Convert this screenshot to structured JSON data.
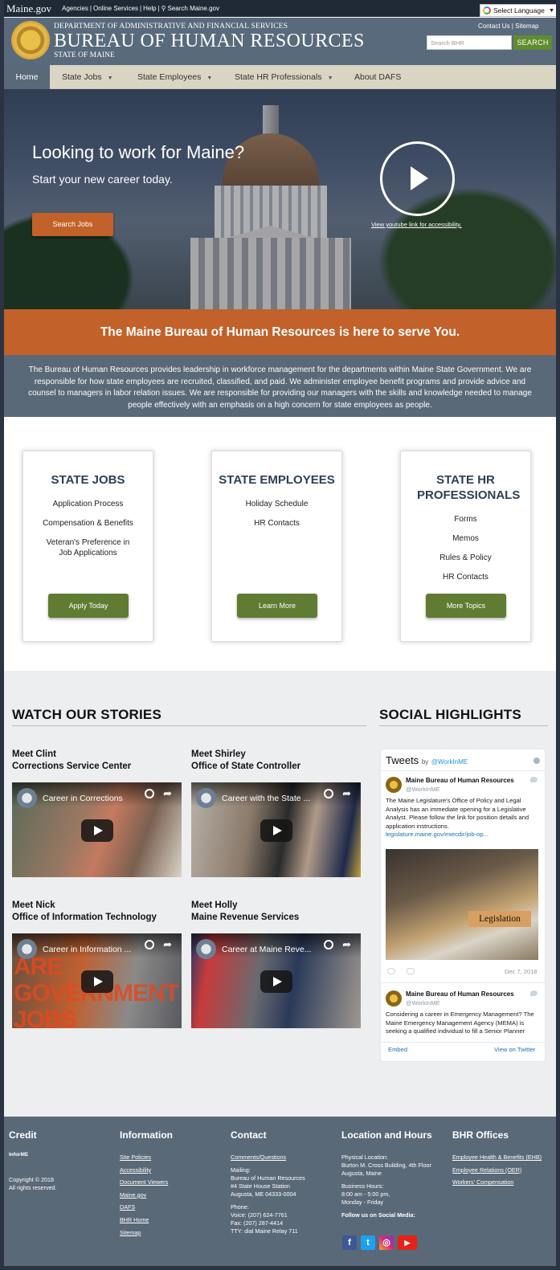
{
  "util": {
    "site": "Maine.gov",
    "links": [
      "Agencies",
      "|",
      "Online Services",
      "|",
      "Help",
      "|",
      "Search Maine.gov"
    ],
    "language": "Select Language"
  },
  "header": {
    "dept": "DEPARTMENT OF ADMINISTRATIVE AND FINANCIAL SERVICES",
    "title": "BUREAU OF HUMAN RESOURCES",
    "state": "STATE OF MAINE",
    "contact": "Contact Us",
    "sep": "|",
    "sitemap": "Sitemap",
    "search_placeholder": "Search BHR",
    "search_button": "SEARCH"
  },
  "nav": {
    "home": "Home",
    "state_jobs": "State Jobs",
    "state_employees": "State Employees",
    "state_hr": "State HR Professionals",
    "about": "About DAFS"
  },
  "hero": {
    "headline": "Looking to work for Maine?",
    "subline": "Start your new career today.",
    "button": "Search Jobs",
    "yt_link": "View youtube link for accessibility."
  },
  "band": "The Maine Bureau of Human Resources is here to serve You.",
  "intro": "The Bureau of Human Resources provides leadership in workforce management for the departments within Maine State Government. We are responsible for how state employees are recruited, classified, and paid. We administer employee benefit programs and provide advice and counsel to managers in labor relation issues. We are responsible for providing our managers with the skills and knowledge needed to manage people effectively with an emphasis on a high concern for state employees as people.",
  "cards": [
    {
      "title": "STATE JOBS",
      "items": [
        "Application Process",
        "Compensation & Benefits",
        "Veteran's Preference in Job Applications"
      ],
      "button": "Apply Today"
    },
    {
      "title": "STATE EMPLOYEES",
      "items": [
        "Holiday Schedule",
        "HR Contacts"
      ],
      "button": "Learn More"
    },
    {
      "title": "STATE HR PROFESSIONALS",
      "items": [
        "Forms",
        "Memos",
        "Rules & Policy",
        "HR Contacts"
      ],
      "button": "More Topics"
    }
  ],
  "stories": {
    "heading": "WATCH OUR STORIES",
    "items": [
      {
        "name": "Meet Clint",
        "org": "Corrections Service Center",
        "video": "Career in Corrections"
      },
      {
        "name": "Meet Shirley",
        "org": "Office of State Controller",
        "video": "Career with the State ..."
      },
      {
        "name": "Meet Nick",
        "org": "Office of Information Technology",
        "video": "Career in Information ...",
        "overlay": [
          "ARE",
          "GOVERNMENT",
          "JOBS"
        ]
      },
      {
        "name": "Meet Holly",
        "org": "Maine Revenue Services",
        "video": "Career at Maine Reve..."
      }
    ]
  },
  "social": {
    "heading": "SOCIAL HIGHLIGHTS",
    "tweets_label": "Tweets",
    "by": "by",
    "handle": "@WorkInME",
    "tweet1": {
      "name": "Maine Bureau of Human Resources",
      "handle": "@WorkInME",
      "text": "The Maine Legislature's Office of Policy and Legal Analysis has an immediate opening for a Legislative Analyst. Please follow the link for position details and application instructions.",
      "link": "legislature.maine.gov/execdir/job-op...",
      "image_tag": "Legislation",
      "date": "Dec 7, 2018"
    },
    "tweet2": {
      "name": "Maine Bureau of Human Resources",
      "handle": "@WorkInME",
      "text": "Considering a career in Emergency Management? The Maine Emergency Management Agency (MEMA) is seeking a qualified individual to fill a Senior Planner"
    },
    "embed": "Embed",
    "view": "View on Twitter"
  },
  "footer": {
    "credit": {
      "heading": "Credit",
      "logo": "InforME",
      "copyright": "Copyright © 2018",
      "rights": "All rights reserved."
    },
    "information": {
      "heading": "Information",
      "links": [
        "Site Policies",
        "Accessibility",
        "Document Viewers",
        "Maine.gov",
        "DAFS",
        "BHR Home",
        "Sitemap"
      ]
    },
    "contact": {
      "heading": "Contact",
      "link": "Comments/Questions",
      "mailing_label": "Mailing:",
      "mailing": [
        "Bureau of Human Resources",
        "#4 State House Station",
        "Augusta, ME 04333-0004"
      ],
      "phone_label": "Phone:",
      "phone": [
        "Voice: (207) 624-7761",
        "Fax: (207) 287-4414",
        "TTY: dial Maine Relay 711"
      ]
    },
    "location": {
      "heading": "Location and Hours",
      "physical_label": "Physical Location:",
      "physical": [
        "Burton M. Cross Building, 4th Floor",
        "Augusta, Maine"
      ],
      "hours_label": "Business Hours:",
      "hours": [
        "8:00 am - 5:00 pm,",
        "Monday - Friday"
      ],
      "follow": "Follow us on Social Media:"
    },
    "offices": {
      "heading": "BHR Offices",
      "links": [
        "Employee Health & Benefits (EHB)",
        "Employee Relations (OER)",
        "Workers' Compensation"
      ]
    }
  },
  "colors": {
    "navy": "#5a6978",
    "orange": "#c2612a",
    "green": "#5f7c32",
    "nav_bg": "#d8d5c2"
  }
}
